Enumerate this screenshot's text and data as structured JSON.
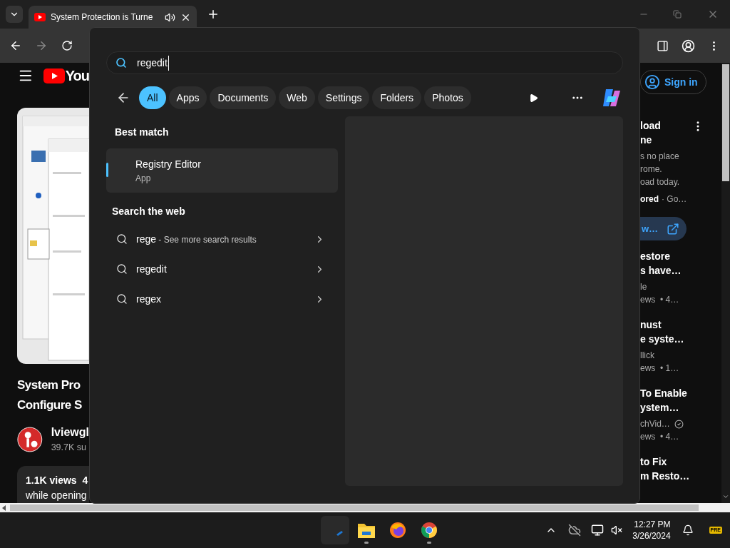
{
  "browser": {
    "tab": {
      "title": "System Protection is Turne"
    }
  },
  "youtube": {
    "logo_text": "You",
    "sign_in": "Sign in",
    "video": {
      "title_lines": [
        "System Pro",
        "Configure S"
      ],
      "channel": "Iviewgl",
      "subscribers": "39.7K su",
      "views": "1.1K views  4",
      "description": "while opening"
    },
    "ad": {
      "title_lines": [
        "load",
        "ne"
      ],
      "description_lines": [
        "s no place",
        "rome.",
        "oad today."
      ],
      "sponsored": "ored",
      "advertiser": "· Go…",
      "button": "w…"
    },
    "videos": [
      {
        "title_lines": [
          "estore",
          "s have…"
        ],
        "channel": "le",
        "meta": "ews  • 4…",
        "verified": false
      },
      {
        "title_lines": [
          "nust",
          "e syste…"
        ],
        "channel": "llick",
        "meta": "ews  • 1…",
        "verified": false
      },
      {
        "title_lines": [
          "To Enable",
          "ystem…"
        ],
        "channel": "chVid…",
        "meta": "ews  • 4…",
        "verified": true
      },
      {
        "title_lines": [
          "to Fix",
          "m Resto…"
        ]
      }
    ]
  },
  "search": {
    "query": "regedit",
    "filters": [
      {
        "label": "All",
        "selected": true
      },
      {
        "label": "Apps",
        "selected": false
      },
      {
        "label": "Documents",
        "selected": false
      },
      {
        "label": "Web",
        "selected": false
      },
      {
        "label": "Settings",
        "selected": false
      },
      {
        "label": "Folders",
        "selected": false
      },
      {
        "label": "Photos",
        "selected": false
      }
    ],
    "best_match_heading": "Best match",
    "best_match": {
      "name": "Registry Editor",
      "type": "App",
      "selected": true
    },
    "web_heading": "Search the web",
    "web_results": [
      {
        "query": "rege",
        "hint": "- See more search results"
      },
      {
        "query": "regedit"
      },
      {
        "query": "regex"
      }
    ]
  },
  "taskbar": {
    "apps": [
      {
        "kind": "start",
        "running": false
      },
      {
        "kind": "explorer",
        "running": true
      },
      {
        "kind": "firefox",
        "running": false
      },
      {
        "kind": "chrome",
        "running": true
      }
    ],
    "time": "12:27 PM",
    "date": "3/26/2024",
    "badge": "PRE"
  }
}
